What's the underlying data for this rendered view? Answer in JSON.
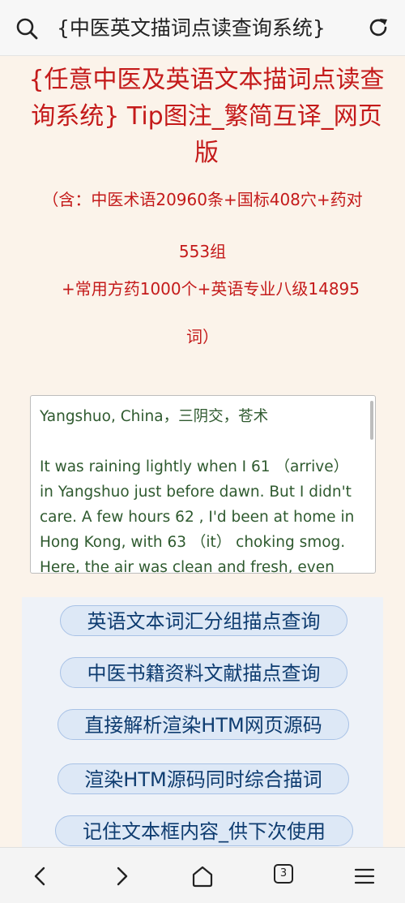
{
  "browser": {
    "page_title": "{中医英文描词点读查询系统}",
    "tab_count": "3"
  },
  "page": {
    "heading": "{任意中医及英语文本描词点读查询系统} Tip图注_繁简互译_网页版",
    "contains": [
      "（含：中医术语20960条+国标408穴+药对",
      "553组",
      "+常用方药1000个+英语专业八级14895",
      "词）"
    ],
    "textbox": "Yangshuo, China，三阴交，苍术\n\nIt was raining lightly when I 61 （arrive） in Yangshuo just before dawn. But I didn't care. A few hours 62 , I'd been at home in Hong Kong, with 63 （it） choking smog. Here, the air was clean and fresh, even with",
    "buttons": [
      "英语文本词汇分组描点查询",
      "中医书籍资料文献描点查询",
      "直接解析渲染HTM网页源码",
      "渲染HTM源码同时综合描词",
      "记住文本框内容_供下次使用"
    ]
  },
  "icons": {
    "search": "search-icon",
    "reload": "reload-icon",
    "back": "back-icon",
    "forward": "forward-icon",
    "home": "home-icon",
    "tabs": "tabs-icon",
    "menu": "menu-icon"
  },
  "colors": {
    "heading": "#c41a1a",
    "text": "#2f5a2f",
    "button_text": "#0e3c70",
    "button_bg": "#dde8f6",
    "page_bg": "#fbf3ea"
  }
}
